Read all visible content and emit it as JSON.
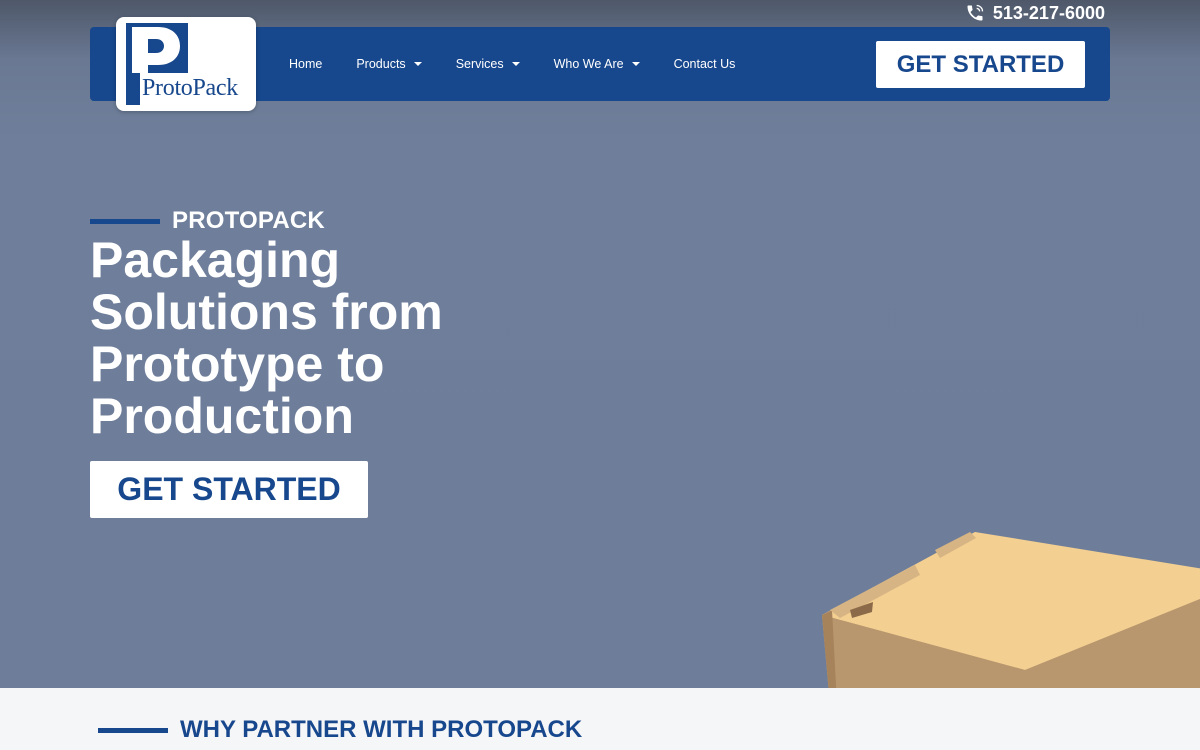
{
  "header": {
    "phone": "513-217-6000",
    "logo_text": "ProtoPack",
    "nav": [
      {
        "label": "Home",
        "has_dropdown": false
      },
      {
        "label": "Products",
        "has_dropdown": true
      },
      {
        "label": "Services",
        "has_dropdown": true
      },
      {
        "label": "Who We Are",
        "has_dropdown": true
      },
      {
        "label": "Contact Us",
        "has_dropdown": false
      }
    ],
    "cta_label": "GET STARTED"
  },
  "hero": {
    "eyebrow": "PROTOPACK",
    "headline": "Packaging Solutions from Prototype to Production",
    "cta_label": "GET STARTED"
  },
  "why_section": {
    "title": "WHY PARTNER WITH PROTOPACK"
  },
  "colors": {
    "brand_blue": "#17478c",
    "hero_bg": "#6e7e9a",
    "white": "#ffffff"
  },
  "icons": {
    "phone": "phone-icon",
    "dropdown": "chevron-down-icon"
  }
}
